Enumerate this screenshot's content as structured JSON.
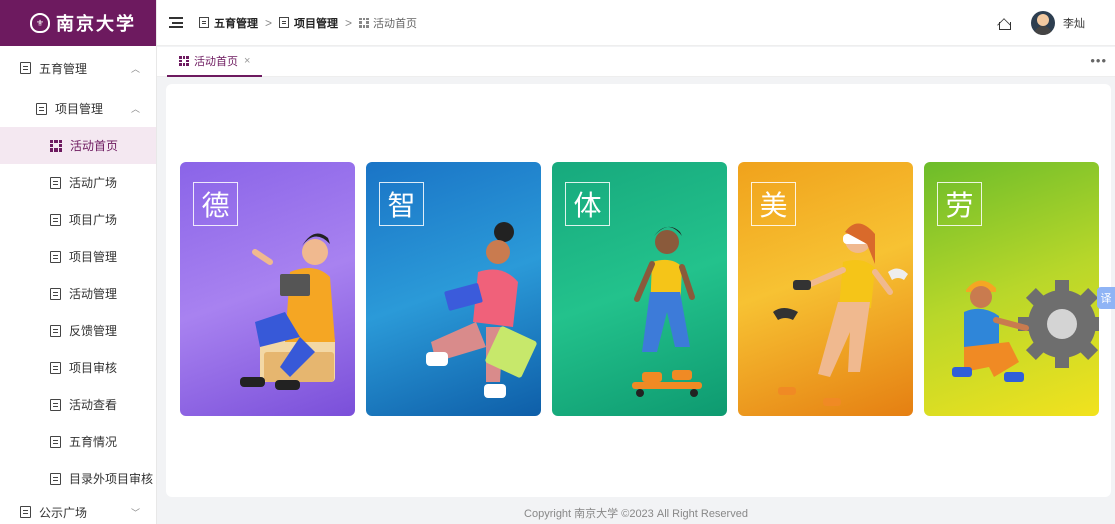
{
  "app": {
    "logo_text": "南京大学",
    "seal_icon": "university-seal-icon",
    "brand_color": "#6d1a5f"
  },
  "sidebar": {
    "items": [
      {
        "label": "五育管理",
        "level": 1,
        "arrow": "^"
      },
      {
        "label": "项目管理",
        "level": 2,
        "arrow": "^"
      },
      {
        "label": "活动首页",
        "level": 3,
        "active": true
      },
      {
        "label": "活动广场",
        "level": 3
      },
      {
        "label": "项目广场",
        "level": 3
      },
      {
        "label": "项目管理",
        "level": 3
      },
      {
        "label": "活动管理",
        "level": 3
      },
      {
        "label": "反馈管理",
        "level": 3
      },
      {
        "label": "项目审核",
        "level": 3
      },
      {
        "label": "活动查看",
        "level": 3
      },
      {
        "label": "五育情况",
        "level": 3
      },
      {
        "label": "目录外项目审核",
        "level": 3
      },
      {
        "label": "公示广场",
        "level": 1,
        "arrow": "v"
      }
    ]
  },
  "header": {
    "breadcrumb": [
      "五育管理",
      "项目管理",
      "活动首页"
    ],
    "separator": ">",
    "username": "李灿"
  },
  "tabs": {
    "items": [
      {
        "label": "活动首页",
        "close": "×"
      }
    ],
    "more": "•••"
  },
  "panels": [
    {
      "char": "德",
      "color": "#8a64e8"
    },
    {
      "char": "智",
      "color": "#1a74c6"
    },
    {
      "char": "体",
      "color": "#17a97d"
    },
    {
      "char": "美",
      "color": "#f0a21c"
    },
    {
      "char": "劳",
      "color": "#b8d72a"
    }
  ],
  "translate_label": "译",
  "footer": "Copyright 南京大学 ©2023 All Right Reserved"
}
